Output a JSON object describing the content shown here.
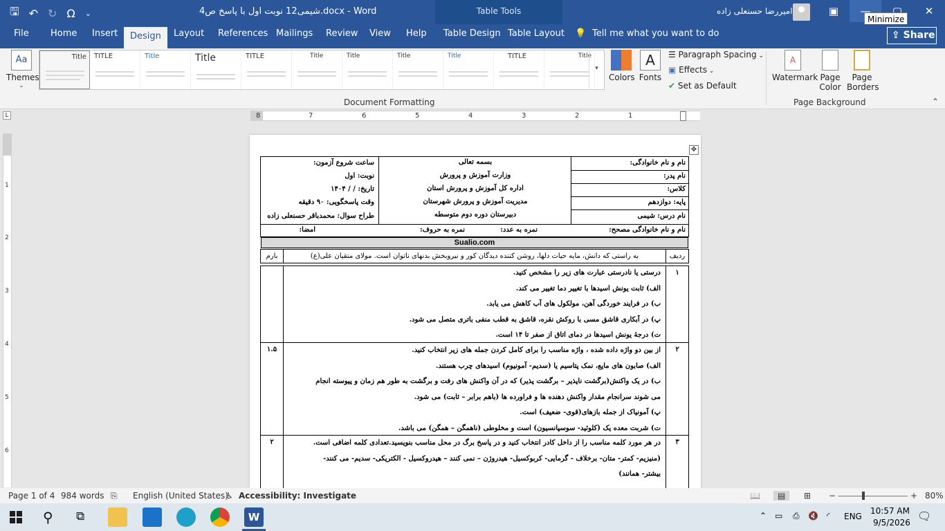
{
  "window": {
    "title": "شیمی12 نوبت اول با پاسخ ص4.docx  -  Word",
    "table_tools": "Table Tools",
    "user_name": "امیررضا حسنعلی زاده",
    "tooltip": "Minimize"
  },
  "tabs": [
    {
      "label": "File"
    },
    {
      "label": "Home"
    },
    {
      "label": "Insert"
    },
    {
      "label": "Design"
    },
    {
      "label": "Layout"
    },
    {
      "label": "References"
    },
    {
      "label": "Mailings"
    },
    {
      "label": "Review"
    },
    {
      "label": "View"
    },
    {
      "label": "Help"
    },
    {
      "label": "Table Design"
    },
    {
      "label": "Table Layout"
    }
  ],
  "tell_me": "Tell me what you want to do",
  "share": "Share",
  "ribbon": {
    "themes": "Themes",
    "colors": "Colors",
    "fonts": "Fonts",
    "paragraph_spacing": "Paragraph Spacing",
    "effects": "Effects",
    "set_default": "Set as Default",
    "group_document_formatting": "Document Formatting",
    "watermark": "Watermark",
    "page_color_1": "Page",
    "page_color_2": "Color",
    "page_borders_1": "Page",
    "page_borders_2": "Borders",
    "group_page_background": "Page Background",
    "style_titles": [
      "Title",
      "TITLE",
      "Title",
      "Title",
      "TITLE",
      "Title",
      "Title",
      "Title",
      "Title",
      "TITLE",
      "Title"
    ]
  },
  "ruler": {
    "h_numbers": [
      "8",
      "7",
      "6",
      "5",
      "4",
      "3",
      "2",
      "1"
    ],
    "v_numbers": [
      "1",
      "2",
      "3",
      "4",
      "5",
      "6"
    ]
  },
  "doc": {
    "header": {
      "name": "نام و نام خانوادگی:",
      "father": "نام پدر:",
      "class": "کلاس:",
      "grade": "پایه: دوازدهم",
      "subject": "نام درس: شیمی",
      "center1": "بسمه تعالی",
      "center2": "وزارت آموزش و پرورش",
      "center3": "اداره کل آموزش و پرورش استان",
      "center4": "مدیریت آموزش و پرورش شهرستان",
      "center5": "دبیرستان دوره دوم متوسطه",
      "start_time": "ساعت شروع آزمون:",
      "turn": "نوبت: اول",
      "date": "تاریخ:    /    /  ۱۴۰۴",
      "duration": "وقت پاسخگویی: ۹۰ دقیقه",
      "designer": "طراح سوال: محمدباقر حسنعلی زاده",
      "corrector": "نام و نام خانوادگی مصحح:",
      "grade_num": "نمره به عدد:",
      "grade_text": "نمره به حروف:",
      "signature": "امضا:"
    },
    "site": "Sualio.com",
    "intro": {
      "row": "ردیف",
      "text": "به راستی که دانش، مایه حیات دلها، روشن کننده دیدگان کور و نیروبخش بدنهای ناتوان است. مولای متقیان علی(ع)",
      "score": "بارم"
    },
    "questions": [
      {
        "num": "۱",
        "score": "",
        "lines": [
          "درستی یا نادرستی عبارت های زیر را مشخص کنید.",
          "الف) ثابت یونش اسیدها با تغییر دما تغییر می کند.",
          "ب) در فرایند خوردگی آهن، مولکول های آب کاهش می یابد.",
          "پ) در آبکاری قاشق مسی با روکش نقره، قاشق به قطب منفی باتری متصل می شود.",
          "ت) درجهٔ یونش اسیدها در دمای اتاق از صفر تا ۱۴ است."
        ]
      },
      {
        "num": "۲",
        "score": "۱.۵",
        "lines": [
          "از بین دو واژه داده شده ، واژه مناسب را برای کامل کردن جمله های زیر انتخاب کنید.",
          "الف) صابون های مایع، نمک پتاسیم یا (سدیم- آمونیوم) اسیدهای چرب هستند.",
          "ب) در یک واکنش(برگشت ناپذیر – برگشت پذیر) که در آن واکنش های رفت و برگشت به طور هم زمان و پیوسته انجام",
          "می شوند سرانجام مقدار واکنش دهنده ها و فراورده ها (باهم برابر – ثابت) می شود.",
          "پ) آمونیاک از جمله بازهای(قوی- ضعیف) است.",
          "ت) شربت معده یک (کلوئید- سوسپانسیون) است و مخلوطی (ناهمگن – همگن) می باشد."
        ]
      },
      {
        "num": "۳",
        "score": "۲",
        "lines": [
          "در هر مورد کلمه مناسب را از داخل کادر انتخاب کنید و در پاسخ برگ در محل مناسب بنویسید.تعدادی کلمه اضافی است.",
          "(منیزیم- کمتر- متان- برخلاف - گرمایی- کربوکسیل- هیدروژن – نمی کنند – هیدروکسیل - الکتریکی- سدیم- می کنند-",
          "بیشتر- همانند)"
        ]
      }
    ]
  },
  "status": {
    "page": "Page 1 of 4",
    "words": "984 words",
    "language": "English (United States)",
    "accessibility": "Accessibility: Investigate",
    "zoom": "80%"
  },
  "taskbar": {
    "lang": "ENG",
    "time": "10:57 AM",
    "date": "9/5/2026"
  }
}
